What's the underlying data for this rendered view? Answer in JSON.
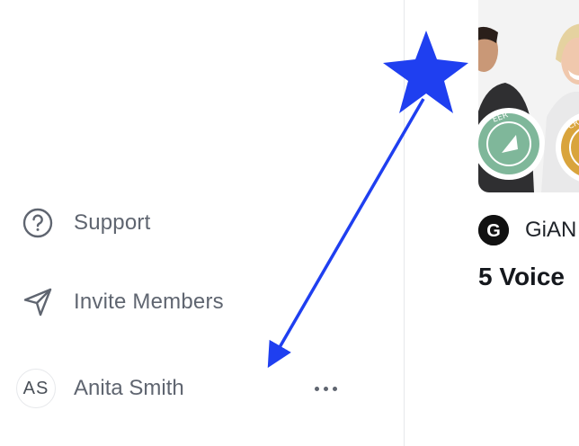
{
  "sidebar": {
    "items": [
      {
        "label": "Support",
        "icon": "question-circle-icon"
      },
      {
        "label": "Invite Members",
        "icon": "send-icon"
      }
    ],
    "user": {
      "initials": "AS",
      "name": "Anita Smith",
      "more_icon": "more-horizontal-icon"
    }
  },
  "card": {
    "source": {
      "logo_letter": "G",
      "name": "GiAN"
    },
    "title": "5 Voice",
    "image_alt": "two-people-holding-badges",
    "badges": {
      "left": "EER",
      "right": "CRE"
    }
  },
  "annotation": {
    "color": "#1f3ff0",
    "shapes": [
      "star-marker",
      "arrow"
    ]
  },
  "colors": {
    "text_muted": "#5f6570",
    "border": "#e6e8eb",
    "badge_green": "#7fb79a",
    "badge_yellow": "#d9a43c"
  }
}
